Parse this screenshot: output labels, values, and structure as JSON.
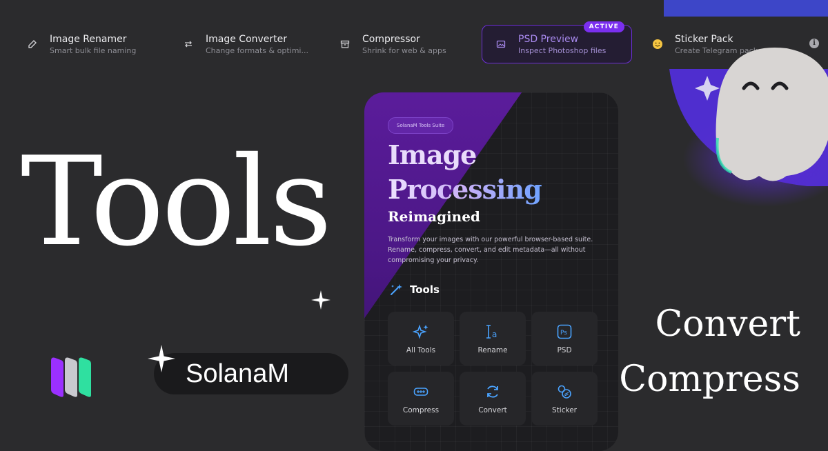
{
  "nav": {
    "items": [
      {
        "title": "Image Renamer",
        "subtitle": "Smart bulk file naming",
        "icon": "edit-icon"
      },
      {
        "title": "Image Converter",
        "subtitle": "Change formats & optimi...",
        "icon": "swap-arrows-icon"
      },
      {
        "title": "Compressor",
        "subtitle": "Shrink for web & apps",
        "icon": "archive-icon"
      },
      {
        "title": "PSD Preview",
        "subtitle": "Inspect Photoshop files",
        "icon": "image-icon",
        "badge": "ACTIVE"
      },
      {
        "title": "Sticker Pack",
        "subtitle": "Create Telegram packs",
        "icon": "smiley-icon"
      }
    ],
    "info_icon": "i"
  },
  "headline": "Tools",
  "brand": {
    "name": "SolanaM",
    "logo": "bars-logo"
  },
  "phone": {
    "chip": "SolanaM Tools Suite",
    "hero_line1": "Image",
    "hero_line2": "Processing",
    "hero_line3": "Reimagined",
    "description": "Transform your images with our powerful browser-based suite. Rename, compress, convert, and edit metadata—all without compromising your privacy.",
    "tools_heading": "Tools",
    "tiles": [
      {
        "label": "All Tools",
        "icon": "sparkles-icon"
      },
      {
        "label": "Rename",
        "icon": "text-cursor-icon"
      },
      {
        "label": "PSD",
        "icon": "ps-file-icon"
      },
      {
        "label": "Compress",
        "icon": "compress-icon"
      },
      {
        "label": "Convert",
        "icon": "refresh-icon"
      },
      {
        "label": "Sticker",
        "icon": "sticker-icon"
      }
    ]
  },
  "taglines": [
    "Convert",
    "Compress"
  ],
  "colors": {
    "background": "#2b2b2d",
    "accent_purple": "#7b2ff0",
    "accent_blue": "#3d46c8",
    "logo_purple": "#9b30ff",
    "logo_grey": "#c9c9cf",
    "logo_green": "#2fe0a0"
  }
}
